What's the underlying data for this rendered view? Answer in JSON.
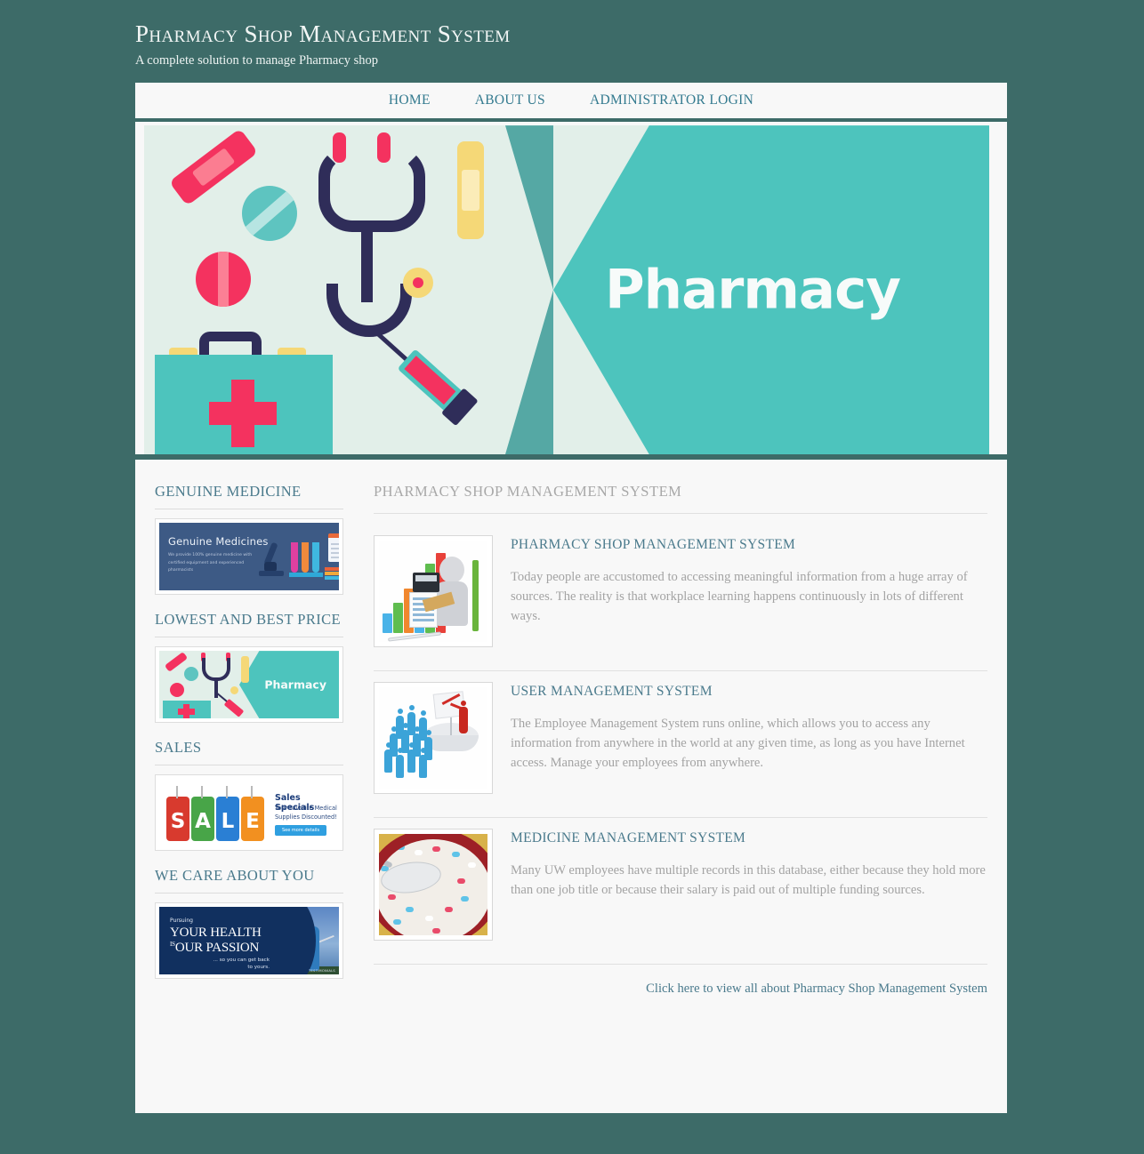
{
  "header": {
    "title": "Pharmacy Shop Management System",
    "tagline": "A complete solution to manage Pharmacy shop"
  },
  "nav": {
    "items": [
      {
        "label": "HOME"
      },
      {
        "label": "ABOUT US"
      },
      {
        "label": "ADMINISTRATOR LOGIN"
      }
    ]
  },
  "hero": {
    "word": "Pharmacy",
    "bg_left": "#e2efe9",
    "bg_right": "#4dc4bd",
    "shadow": "#55a8a4"
  },
  "sidebar": {
    "sections": [
      {
        "heading": "GENUINE MEDICINE",
        "banner": {
          "kind": "genuine-medicines",
          "title": "Genuine Medicines",
          "subtitle": "We provide 100% genuine medicine with certified equipment and experienced pharmacists",
          "bg": "#3d5a85"
        }
      },
      {
        "heading": "LOWEST AND BEST PRICE",
        "banner": {
          "kind": "pharmacy-mini",
          "word": "Pharmacy",
          "bg": "#e2efe9",
          "panel": "#4dc4bd"
        }
      },
      {
        "heading": "SALES",
        "banner": {
          "kind": "sale",
          "letters": [
            "S",
            "A",
            "L",
            "E"
          ],
          "title": "Sales Specials",
          "subtitle": "Your Favorite Medical Supplies Discounted!",
          "button": "See more details"
        }
      },
      {
        "heading": "WE CARE ABOUT YOU",
        "banner": {
          "kind": "health-passion",
          "pre": "Pursuing",
          "line1": "YOUR HEALTH",
          "line2_sup": "IS",
          "line2": "OUR PASSION",
          "tail": "... so you can get back to yours.",
          "badge": "TESTIMONIALS"
        }
      }
    ]
  },
  "content": {
    "heading": "PHARMACY SHOP MANAGEMENT SYSTEM",
    "articles": [
      {
        "title": "PHARMACY SHOP MANAGEMENT SYSTEM",
        "text": "Today people are accustomed to accessing meaningful information from a huge array of sources. The reality is that workplace learning happens continuously in lots of different ways.",
        "image": "bar-chart-figure"
      },
      {
        "title": "USER MANAGEMENT SYSTEM",
        "text": "The Employee Management System runs online, which allows you to access any information from anywhere in the world at any given time, as long as you have Internet access. Manage your employees from anywhere.",
        "image": "crowd-leader-flag"
      },
      {
        "title": "MEDICINE MANAGEMENT SYSTEM",
        "text": "Many UW employees have multiple records in this database, either because they hold more than one job title or because their salary is paid out of multiple funding sources.",
        "image": "pills-bowl-spoon"
      }
    ],
    "footer_link": "Click here to view all about Pharmacy Shop Management System"
  },
  "theme": {
    "page_bg": "#3d6b68",
    "panel_bg": "#f8f8f8",
    "link": "#4a7a8c",
    "nav_link": "#337a8f",
    "muted_text": "#a3a3a3"
  }
}
